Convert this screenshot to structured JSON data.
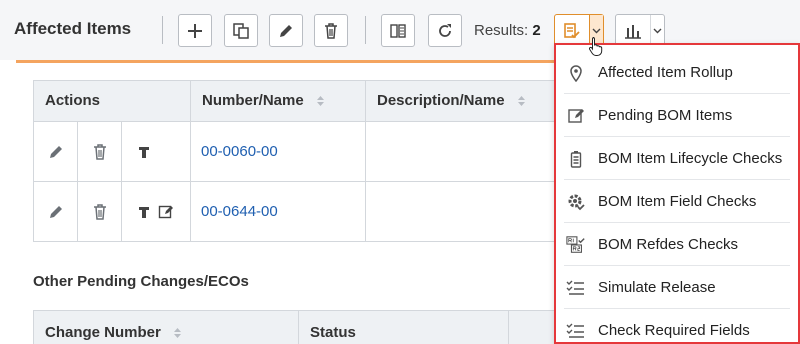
{
  "toolbar": {
    "title": "Affected Items",
    "results_label": "Results:",
    "results_count": "2"
  },
  "table": {
    "columns": [
      "Actions",
      "Number/Name",
      "Description/Name"
    ],
    "rows": [
      {
        "number": "00-0060-00"
      },
      {
        "number": "00-0644-00"
      }
    ]
  },
  "other": {
    "section_title": "Other Pending Changes/ECOs",
    "columns": [
      "Change Number",
      "Status"
    ]
  },
  "dropdown": {
    "items": [
      {
        "label": "Affected Item Rollup",
        "icon": "map-pin-icon"
      },
      {
        "label": "Pending BOM Items",
        "icon": "edit-box-icon"
      },
      {
        "label": "BOM Item Lifecycle Checks",
        "icon": "battery-icon"
      },
      {
        "label": "BOM Item Field Checks",
        "icon": "gear-check-icon"
      },
      {
        "label": "BOM Refdes Checks",
        "icon": "refdes-check-icon"
      },
      {
        "label": "Simulate Release",
        "icon": "checklist-icon"
      },
      {
        "label": "Check Required Fields",
        "icon": "checklist-icon"
      }
    ]
  },
  "colors": {
    "accent_orange": "#e08e2b",
    "highlight_red": "#e5383b",
    "link_blue": "#1f5fb0"
  }
}
